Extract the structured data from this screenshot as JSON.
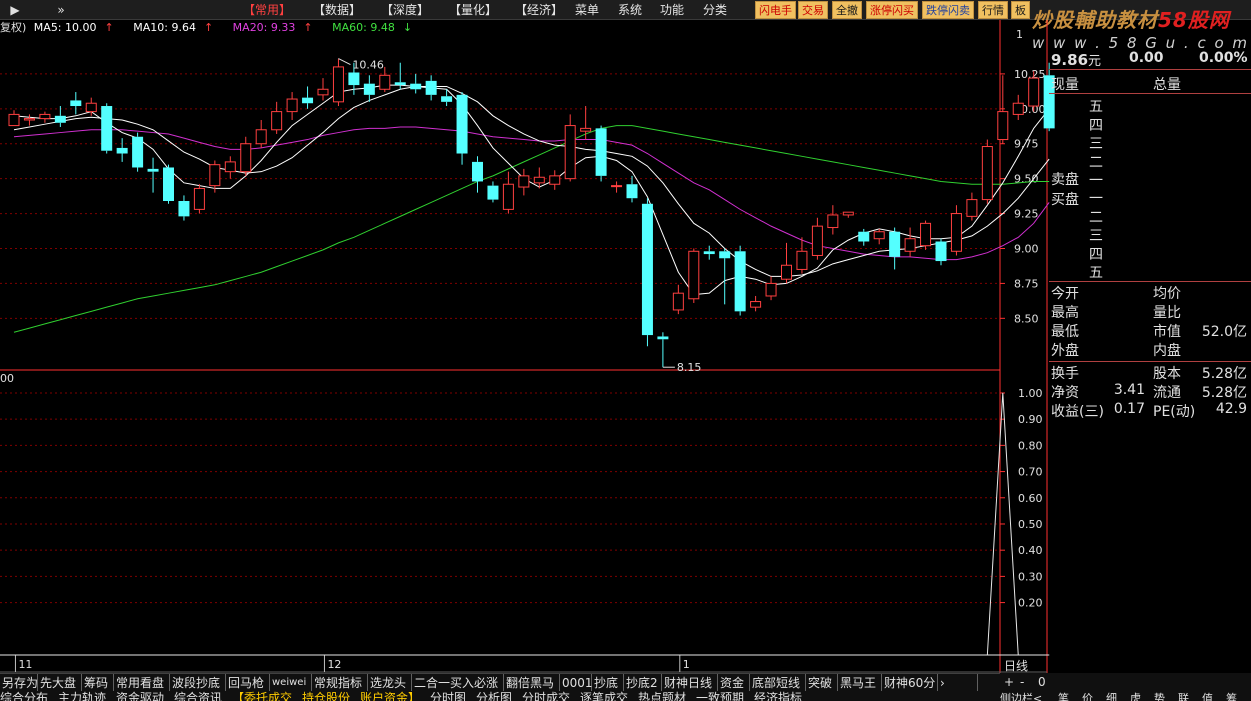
{
  "nav": {
    "play_icon": "▶",
    "expand_icon": "»"
  },
  "menu": [
    {
      "label": "【常用】",
      "active": true
    },
    {
      "label": "【数据】"
    },
    {
      "label": "【深度】"
    },
    {
      "label": "【量化】"
    },
    {
      "label": "【经济】"
    },
    {
      "label": "菜单"
    },
    {
      "label": "系统"
    },
    {
      "label": "功能"
    },
    {
      "label": "分类"
    }
  ],
  "toolbar": [
    "闪电手",
    "交易",
    "全撤",
    "涨停闪买",
    "跌停闪卖",
    "行情",
    "板"
  ],
  "watermark": {
    "text": "炒股輔助教材",
    "brand": "58股网",
    "url": "www.58Gu.com"
  },
  "ma_legend": {
    "prefix": "复权)",
    "items": [
      {
        "label": "MA5: 10.00",
        "arrow": "↑",
        "color": "#ffffff"
      },
      {
        "label": "MA10: 9.64",
        "arrow": "↑",
        "color": "#ffffff"
      },
      {
        "label": "MA20: 9.33",
        "arrow": "↑",
        "color": "#e040e0"
      },
      {
        "label": "MA60: 9.48",
        "arrow": "↓",
        "color": "#40e040"
      }
    ]
  },
  "colors": {
    "up": "#ff4040",
    "down": "#54ffff",
    "ma5": "#ffffff",
    "ma10": "#ffffff",
    "ma20": "#d030d0",
    "ma60": "#30d030",
    "grid": "#800000",
    "axis": "#ff3030"
  },
  "chart_data": {
    "type": "candlestick",
    "main_axis": {
      "ticks": [
        10.25,
        10.0,
        9.75,
        9.5,
        9.25,
        9.0,
        8.75,
        8.5
      ],
      "top_label": "1",
      "ylim": [
        8.13,
        10.55
      ]
    },
    "sub_axis": {
      "ticks": [
        1.0,
        0.9,
        0.8,
        0.7,
        0.6,
        0.5,
        0.4,
        0.3,
        0.2
      ],
      "ylim": [
        0,
        1.08
      ],
      "top_label": "00"
    },
    "x_labels": [
      {
        "label": "11",
        "index": 1
      },
      {
        "label": "12",
        "index": 21
      },
      {
        "label": "1",
        "index": 44
      }
    ],
    "max_label": "10.46",
    "min_label": "8.15",
    "candles": [
      [
        9.88,
        9.96,
        9.9,
        9.99
      ],
      [
        9.92,
        9.93,
        9.88,
        9.96
      ],
      [
        9.93,
        9.96,
        9.9,
        9.98
      ],
      [
        9.95,
        9.9,
        9.87,
        10.02
      ],
      [
        10.06,
        10.02,
        9.96,
        10.12
      ],
      [
        9.98,
        10.04,
        9.95,
        10.08
      ],
      [
        10.02,
        9.7,
        9.68,
        10.04
      ],
      [
        9.72,
        9.68,
        9.62,
        9.79
      ],
      [
        9.8,
        9.58,
        9.55,
        9.83
      ],
      [
        9.57,
        9.55,
        9.4,
        9.65
      ],
      [
        9.58,
        9.34,
        9.32,
        9.6
      ],
      [
        9.34,
        9.23,
        9.2,
        9.38
      ],
      [
        9.28,
        9.43,
        9.25,
        9.46
      ],
      [
        9.45,
        9.6,
        9.4,
        9.63
      ],
      [
        9.55,
        9.62,
        9.5,
        9.66
      ],
      [
        9.55,
        9.75,
        9.52,
        9.8
      ],
      [
        9.75,
        9.85,
        9.72,
        9.92
      ],
      [
        9.85,
        9.98,
        9.82,
        10.05
      ],
      [
        9.98,
        10.07,
        9.92,
        10.12
      ],
      [
        10.08,
        10.04,
        10.0,
        10.16
      ],
      [
        10.1,
        10.14,
        10.06,
        10.22
      ],
      [
        10.05,
        10.3,
        10.02,
        10.36
      ],
      [
        10.26,
        10.17,
        10.1,
        10.33
      ],
      [
        10.18,
        10.1,
        10.05,
        10.24
      ],
      [
        10.14,
        10.24,
        10.12,
        10.3
      ],
      [
        10.19,
        10.17,
        10.14,
        10.33
      ],
      [
        10.18,
        10.14,
        10.11,
        10.25
      ],
      [
        10.2,
        10.1,
        10.06,
        10.24
      ],
      [
        10.09,
        10.05,
        10.02,
        10.14
      ],
      [
        10.1,
        9.68,
        9.6,
        10.12
      ],
      [
        9.62,
        9.48,
        9.4,
        9.66
      ],
      [
        9.45,
        9.35,
        9.33,
        9.48
      ],
      [
        9.28,
        9.46,
        9.25,
        9.55
      ],
      [
        9.44,
        9.52,
        9.38,
        9.57
      ],
      [
        9.47,
        9.51,
        9.43,
        9.58
      ],
      [
        9.46,
        9.52,
        9.42,
        9.56
      ],
      [
        9.5,
        9.88,
        9.48,
        9.96
      ],
      [
        9.84,
        9.86,
        9.78,
        10.02
      ],
      [
        9.86,
        9.52,
        9.48,
        9.88
      ],
      [
        9.45,
        9.45,
        9.4,
        9.48
      ],
      [
        9.46,
        9.36,
        9.33,
        9.52
      ],
      [
        9.32,
        8.38,
        8.3,
        9.36
      ],
      [
        8.37,
        8.35,
        8.15,
        8.4
      ],
      [
        8.56,
        8.68,
        8.53,
        8.74
      ],
      [
        8.64,
        8.98,
        8.61,
        9.0
      ],
      [
        8.98,
        8.96,
        8.92,
        9.02
      ],
      [
        8.98,
        8.93,
        8.6,
        9.0
      ],
      [
        8.98,
        8.55,
        8.52,
        9.02
      ],
      [
        8.58,
        8.62,
        8.55,
        8.66
      ],
      [
        8.66,
        8.75,
        8.63,
        8.8
      ],
      [
        8.78,
        8.88,
        8.75,
        9.04
      ],
      [
        8.85,
        8.98,
        8.82,
        9.08
      ],
      [
        8.95,
        9.16,
        8.92,
        9.22
      ],
      [
        9.15,
        9.24,
        9.1,
        9.31
      ],
      [
        9.24,
        9.26,
        9.22,
        9.25
      ],
      [
        9.12,
        9.05,
        9.02,
        9.14
      ],
      [
        9.07,
        9.12,
        9.03,
        9.14
      ],
      [
        9.12,
        8.94,
        8.85,
        9.15
      ],
      [
        8.98,
        9.07,
        8.94,
        9.15
      ],
      [
        9.02,
        9.18,
        8.99,
        9.2
      ],
      [
        9.05,
        8.91,
        8.88,
        9.07
      ],
      [
        8.98,
        9.25,
        8.95,
        9.31
      ],
      [
        9.23,
        9.35,
        9.2,
        9.4
      ],
      [
        9.35,
        9.73,
        9.32,
        9.78
      ],
      [
        9.78,
        9.98,
        9.75,
        10.24
      ],
      [
        9.96,
        10.04,
        9.92,
        10.1
      ],
      [
        10.02,
        10.22,
        9.98,
        10.27
      ],
      [
        10.24,
        9.86,
        9.84,
        10.33
      ]
    ],
    "ma5": [
      9.95,
      9.94,
      9.93,
      9.93,
      9.95,
      9.98,
      9.9,
      9.83,
      9.79,
      9.71,
      9.57,
      9.47,
      9.45,
      9.43,
      9.43,
      9.52,
      9.63,
      9.76,
      9.88,
      9.96,
      10.04,
      10.12,
      10.14,
      10.15,
      10.17,
      10.17,
      10.16,
      10.15,
      10.14,
      10.03,
      9.88,
      9.72,
      9.61,
      9.5,
      9.44,
      9.49,
      9.58,
      9.65,
      9.66,
      9.63,
      9.55,
      9.37,
      9.1,
      8.83,
      8.67,
      8.68,
      8.77,
      8.8,
      8.78,
      8.74,
      8.75,
      8.8,
      8.86,
      8.99,
      9.06,
      9.11,
      9.14,
      9.12,
      9.09,
      9.07,
      9.07,
      9.08,
      9.16,
      9.31,
      9.47,
      9.66,
      9.86,
      10.0
    ],
    "ma10": [
      9.85,
      9.87,
      9.89,
      9.91,
      9.93,
      9.94,
      9.93,
      9.92,
      9.89,
      9.85,
      9.77,
      9.69,
      9.64,
      9.58,
      9.56,
      9.54,
      9.55,
      9.59,
      9.65,
      9.74,
      9.83,
      9.93,
      10.01,
      10.06,
      10.1,
      10.14,
      10.16,
      10.16,
      10.16,
      10.11,
      10.05,
      9.95,
      9.88,
      9.82,
      9.77,
      9.74,
      9.73,
      9.71,
      9.7,
      9.68,
      9.66,
      9.59,
      9.47,
      9.32,
      9.18,
      9.11,
      9.0,
      8.91,
      8.85,
      8.8,
      8.8,
      8.81,
      8.84,
      8.89,
      8.92,
      8.95,
      8.98,
      8.99,
      9.0,
      9.02,
      9.04,
      9.06,
      9.09,
      9.16,
      9.25,
      9.36,
      9.5,
      9.64
    ],
    "ma20": [
      9.8,
      9.81,
      9.82,
      9.83,
      9.84,
      9.85,
      9.85,
      9.85,
      9.84,
      9.83,
      9.82,
      9.79,
      9.76,
      9.73,
      9.71,
      9.71,
      9.72,
      9.74,
      9.76,
      9.78,
      9.81,
      9.83,
      9.85,
      9.86,
      9.86,
      9.87,
      9.87,
      9.86,
      9.85,
      9.84,
      9.82,
      9.8,
      9.79,
      9.78,
      9.77,
      9.77,
      9.78,
      9.78,
      9.78,
      9.76,
      9.74,
      9.68,
      9.61,
      9.54,
      9.47,
      9.42,
      9.35,
      9.28,
      9.22,
      9.16,
      9.11,
      9.06,
      9.02,
      9.0,
      8.98,
      8.96,
      8.95,
      8.94,
      8.94,
      8.93,
      8.92,
      8.92,
      8.94,
      8.97,
      9.02,
      9.08,
      9.18,
      9.33
    ],
    "ma60": [
      8.4,
      8.43,
      8.46,
      8.49,
      8.52,
      8.55,
      8.58,
      8.61,
      8.64,
      8.66,
      8.68,
      8.7,
      8.72,
      8.74,
      8.77,
      8.8,
      8.83,
      8.87,
      8.91,
      8.95,
      8.99,
      9.04,
      9.08,
      9.13,
      9.18,
      9.23,
      9.28,
      9.33,
      9.38,
      9.43,
      9.48,
      9.52,
      9.57,
      9.62,
      9.67,
      9.72,
      9.77,
      9.82,
      9.86,
      9.88,
      9.88,
      9.86,
      9.84,
      9.82,
      9.8,
      9.78,
      9.76,
      9.74,
      9.72,
      9.7,
      9.68,
      9.66,
      9.64,
      9.62,
      9.6,
      9.58,
      9.56,
      9.54,
      9.52,
      9.5,
      9.48,
      9.47,
      9.46,
      9.46,
      9.46,
      9.47,
      9.48,
      9.48
    ],
    "signal": [
      0,
      0,
      0,
      0,
      0,
      0,
      0,
      0,
      0,
      0,
      0,
      0,
      0,
      0,
      0,
      0,
      0,
      0,
      0,
      0,
      0,
      0,
      0,
      0,
      0,
      0,
      0,
      0,
      0,
      0,
      0,
      0,
      0,
      0,
      0,
      0,
      0,
      0,
      0,
      0,
      0,
      0,
      0,
      0,
      0,
      0,
      0,
      0,
      0,
      0,
      0,
      0,
      0,
      0,
      0,
      0,
      0,
      0,
      0,
      0,
      0,
      0,
      0,
      0,
      1,
      0,
      0,
      0
    ]
  },
  "quote": {
    "price": "9.86",
    "price_unit": "元",
    "change": "0.00",
    "pct": "0.00%",
    "xianliang": "现量",
    "zongliang": "总量",
    "sell_levels": [
      "五",
      "四",
      "三",
      "二",
      "一"
    ],
    "buy_levels": [
      "一",
      "二",
      "三",
      "四",
      "五"
    ],
    "sell_label": "卖盘",
    "buy_label": "买盘",
    "stats": [
      {
        "l1": "今开",
        "v1": "",
        "l2": "均价",
        "v2": ""
      },
      {
        "l1": "最高",
        "v1": "",
        "l2": "量比",
        "v2": ""
      },
      {
        "l1": "最低",
        "v1": "",
        "l2": "市值",
        "v2": "52.0亿"
      },
      {
        "l1": "外盘",
        "v1": "",
        "l2": "内盘",
        "v2": ""
      }
    ],
    "finance": [
      {
        "l1": "换手",
        "v1": "",
        "l2": "股本",
        "v2": "5.28亿"
      },
      {
        "l1": "净资",
        "v1": "3.41",
        "l2": "流通",
        "v2": "5.28亿"
      },
      {
        "l1": "收益(三)",
        "v1": "0.17",
        "l2": "PE(动)",
        "v2": "42.9"
      }
    ]
  },
  "indicator_tabs": [
    "另存为",
    "先大盘",
    "筹码",
    "常用看盘",
    "波段抄底",
    "回马枪",
    "weiwei",
    "常规指标",
    "选龙头",
    "二合一买入必涨",
    "翻倍黑马",
    "0001",
    "抄底",
    "抄底2",
    "财神日线",
    "资金",
    "底部短线",
    "突破",
    "黑马王",
    "财神60分",
    "›"
  ],
  "bottom_tabs": [
    {
      "label": "综合分布"
    },
    {
      "label": "主力轨迹"
    },
    {
      "label": "资金驱动"
    },
    {
      "label": "综合资讯"
    },
    {
      "label": "【委托成交",
      "hl": true
    },
    {
      "label": "持仓股份",
      "hl": true
    },
    {
      "label": "账户资金】",
      "hl": true
    },
    {
      "label": "分时图"
    },
    {
      "label": "分析图"
    },
    {
      "label": "分时成交"
    },
    {
      "label": "逐笔成交"
    },
    {
      "label": "热点题材"
    },
    {
      "label": "一致预期"
    },
    {
      "label": "经济指标"
    }
  ],
  "period": "日线",
  "right_bottom": {
    "plus": "+",
    "minus": "-",
    "zero": "0",
    "side": "侧边栏<",
    "tabs": [
      "笔",
      "价",
      "细",
      "虎",
      "势",
      "联",
      "值",
      "筹"
    ]
  }
}
